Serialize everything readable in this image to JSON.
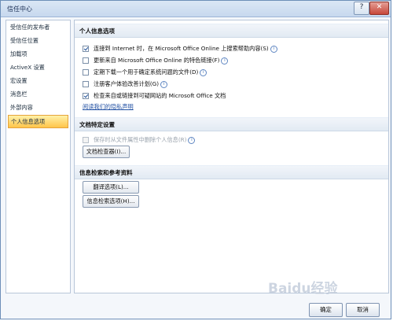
{
  "window": {
    "title": "信任中心",
    "help_glyph": "?",
    "close_glyph": "✕"
  },
  "sidebar": {
    "items": [
      {
        "label": "受信任的发布者"
      },
      {
        "label": "受信任位置"
      },
      {
        "label": "加载项"
      },
      {
        "label": "ActiveX 设置"
      },
      {
        "label": "宏设置"
      },
      {
        "label": "消息栏"
      },
      {
        "label": "外部内容"
      },
      {
        "label": "个人信息选项",
        "active": true
      }
    ]
  },
  "personal": {
    "heading": "个人信息选项",
    "options": [
      {
        "label": "连接到 Internet 时，在 Microsoft Office Online 上搜索帮助内容(S)",
        "checked": true,
        "info": true
      },
      {
        "label": "更新来自 Microsoft Office Online 的特色链接(F)",
        "checked": false,
        "info": true
      },
      {
        "label": "定期下载一个用于确定系统问题的文件(D)",
        "checked": false,
        "info": true
      },
      {
        "label": "注册客户体验改善计划(G)",
        "checked": false,
        "info": true
      },
      {
        "label": "检查来自或链接到可疑网站的 Microsoft Office 文档",
        "checked": true,
        "info": false
      }
    ],
    "privacy_link": "阅读我们的隐私声明"
  },
  "document": {
    "heading": "文档特定设置",
    "option": "保存时从文件属性中删除个人信息(R)",
    "inspector_button": "文档检查器(I)..."
  },
  "research": {
    "heading": "信息检索和参考资料",
    "translation_button": "翻译选项(L)...",
    "research_button": "信息检索选项(H)..."
  },
  "footer": {
    "ok": "确定",
    "cancel": "取消"
  },
  "info_icon_glyph": "i",
  "watermark": "Baidu经验"
}
